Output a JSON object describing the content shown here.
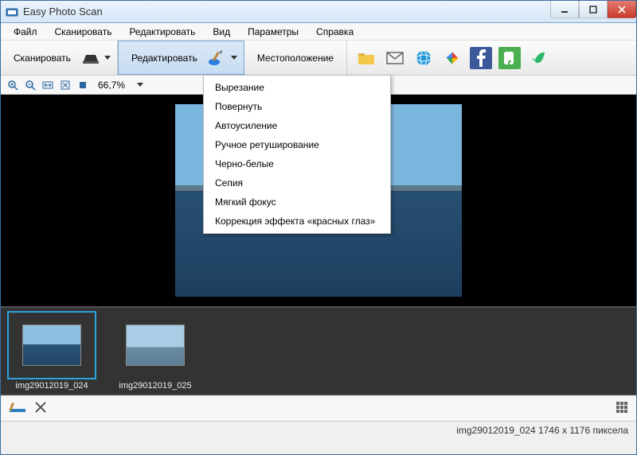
{
  "app": {
    "title": "Easy Photo Scan"
  },
  "menubar": {
    "items": [
      {
        "label": "Файл"
      },
      {
        "label": "Сканировать"
      },
      {
        "label": "Редактировать"
      },
      {
        "label": "Вид"
      },
      {
        "label": "Параметры"
      },
      {
        "label": "Справка"
      }
    ]
  },
  "toolbar": {
    "scan_label": "Сканировать",
    "edit_label": "Редактировать",
    "destination_label": "Местоположение"
  },
  "zoom": {
    "value": "66,7%"
  },
  "edit_menu": {
    "items": [
      {
        "label": "Вырезание"
      },
      {
        "label": "Повернуть"
      },
      {
        "label": "Автоусиление"
      },
      {
        "label": "Ручное ретуширование"
      },
      {
        "label": "Черно-белые"
      },
      {
        "label": "Сепия"
      },
      {
        "label": "Мягкий фокус"
      },
      {
        "label": "Коррекция эффекта «красных глаз»"
      }
    ]
  },
  "thumbnails": [
    {
      "label": "img29012019_024",
      "selected": true
    },
    {
      "label": "img29012019_025",
      "selected": false
    }
  ],
  "status": {
    "text": "img29012019_024 1746 x 1176 пиксела"
  }
}
